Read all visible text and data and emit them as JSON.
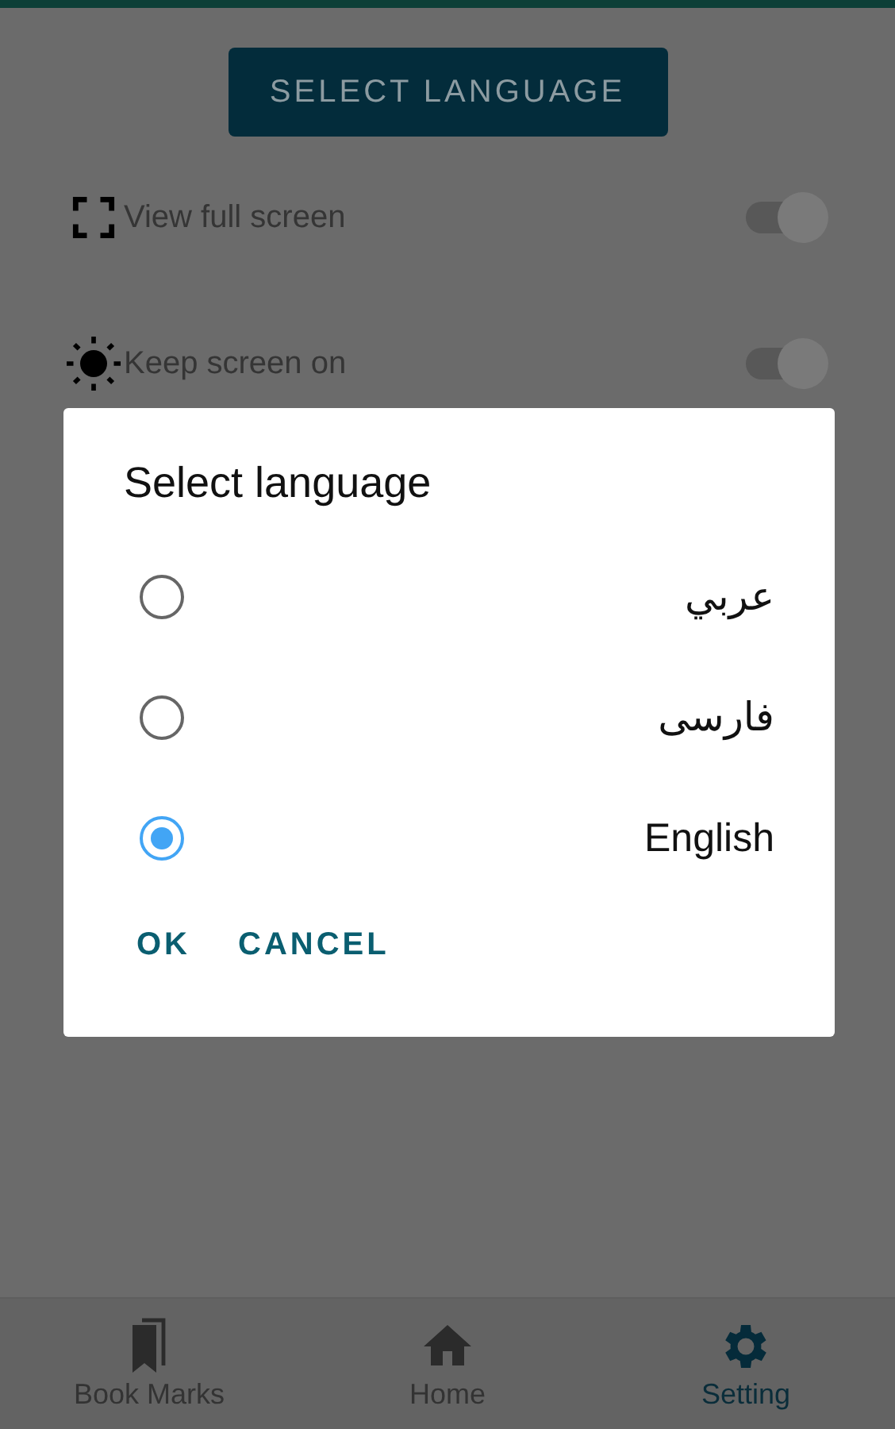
{
  "header": {
    "button": "SELECT LANGUAGE"
  },
  "settings": [
    {
      "kind": "fullscreen",
      "label": "View full screen",
      "on": true
    },
    {
      "kind": "brightness",
      "label": "Keep screen on",
      "on": true
    }
  ],
  "dialog": {
    "title": "Select language",
    "options": [
      {
        "label": "عربي",
        "selected": false
      },
      {
        "label": "فارسی",
        "selected": false
      },
      {
        "label": "English",
        "selected": true
      }
    ],
    "buttons": [
      "OK",
      "CANCEL"
    ]
  },
  "bottom_nav": [
    {
      "kind": "bookmarks",
      "label": "Book Marks",
      "selected": false
    },
    {
      "kind": "home",
      "label": "Home",
      "selected": false
    },
    {
      "kind": "settings",
      "label": "Setting",
      "selected": true
    }
  ]
}
